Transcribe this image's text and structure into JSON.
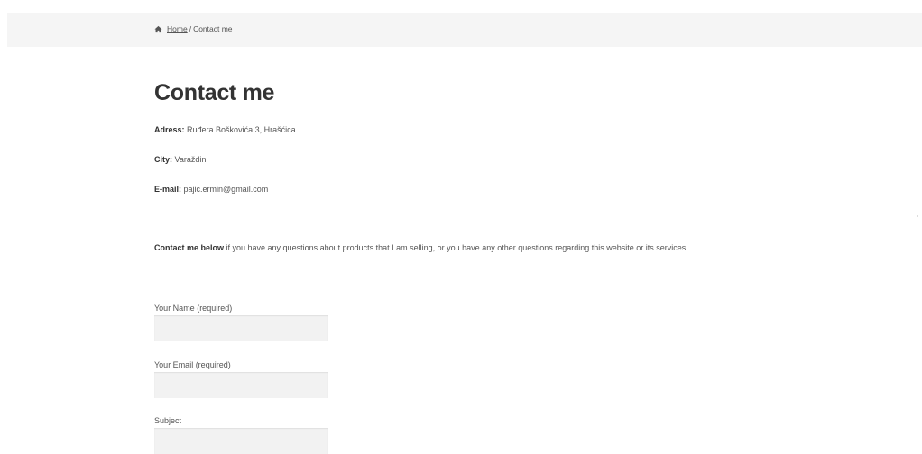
{
  "breadcrumb": {
    "home_label": "Home",
    "separator": "/",
    "current": "Contact me",
    "icon": "home-icon"
  },
  "page": {
    "title": "Contact me"
  },
  "info": {
    "address_label": "Adress:",
    "address_value": "Ruđera Boškovića 3, Hrašćica",
    "city_label": "City:",
    "city_value": "Varaždin",
    "email_label": "E-mail:",
    "email_value": "pajic.ermin@gmail.com"
  },
  "intro": {
    "bold": "Contact me below",
    "text": " if you have any questions about products that I am selling, or you have any other questions regarding this website or its services."
  },
  "form": {
    "name_label": "Your Name (required)",
    "name_value": "",
    "email_label": "Your Email (required)",
    "email_value": "",
    "subject_label": "Subject",
    "subject_value": ""
  },
  "colors": {
    "breadcrumb_bg": "#f5f5f5",
    "input_bg": "#f2f2f2",
    "title": "#333333",
    "text": "#555555"
  }
}
